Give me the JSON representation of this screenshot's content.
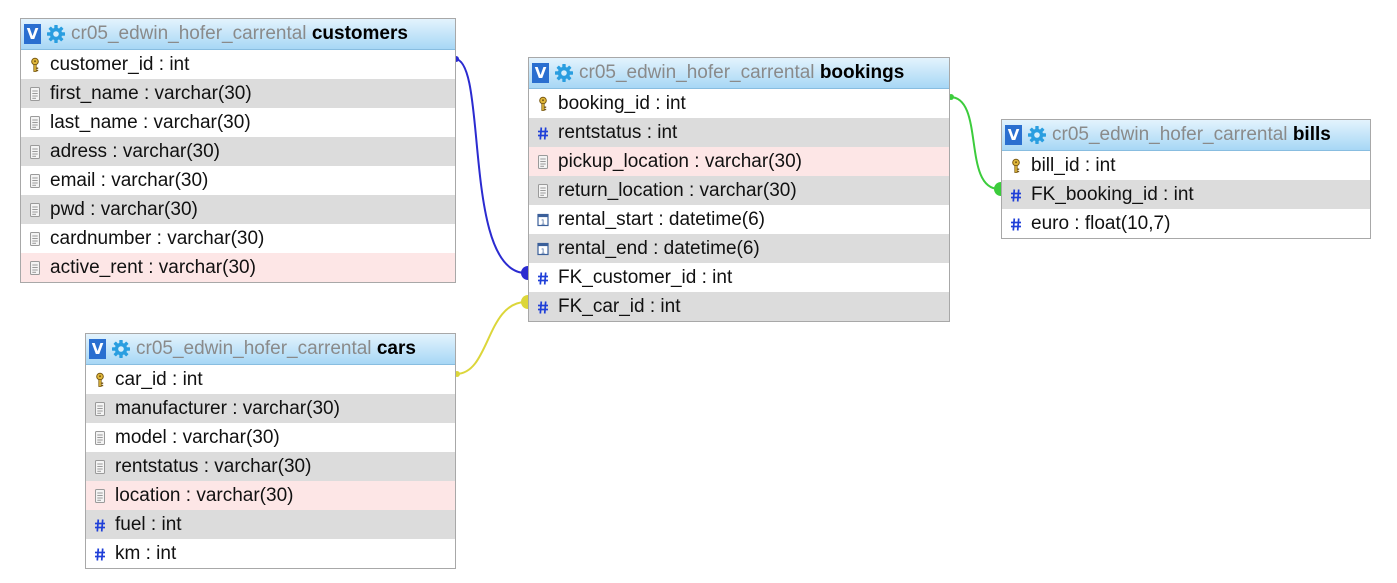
{
  "tables": {
    "customers": {
      "db": "cr05_edwin_hofer_carrental",
      "name": "customers",
      "columns": [
        {
          "label": "customer_id : int",
          "icon": "primary-key-icon"
        },
        {
          "label": "first_name : varchar(30)",
          "icon": "text-column-icon"
        },
        {
          "label": "last_name : varchar(30)",
          "icon": "text-column-icon"
        },
        {
          "label": "adress : varchar(30)",
          "icon": "text-column-icon"
        },
        {
          "label": "email : varchar(30)",
          "icon": "text-column-icon"
        },
        {
          "label": "pwd : varchar(30)",
          "icon": "text-column-icon"
        },
        {
          "label": "cardnumber : varchar(30)",
          "icon": "text-column-icon"
        },
        {
          "label": "active_rent : varchar(30)",
          "icon": "text-column-icon"
        }
      ]
    },
    "bookings": {
      "db": "cr05_edwin_hofer_carrental",
      "name": "bookings",
      "columns": [
        {
          "label": "booking_id : int",
          "icon": "primary-key-icon"
        },
        {
          "label": "rentstatus : int",
          "icon": "numeric-column-icon"
        },
        {
          "label": "pickup_location : varchar(30)",
          "icon": "text-column-icon"
        },
        {
          "label": "return_location : varchar(30)",
          "icon": "text-column-icon"
        },
        {
          "label": "rental_start : datetime(6)",
          "icon": "date-column-icon"
        },
        {
          "label": "rental_end : datetime(6)",
          "icon": "date-column-icon"
        },
        {
          "label": "FK_customer_id : int",
          "icon": "numeric-column-icon"
        },
        {
          "label": "FK_car_id : int",
          "icon": "numeric-column-icon"
        }
      ]
    },
    "bills": {
      "db": "cr05_edwin_hofer_carrental",
      "name": "bills",
      "columns": [
        {
          "label": "bill_id : int",
          "icon": "primary-key-icon"
        },
        {
          "label": "FK_booking_id : int",
          "icon": "numeric-column-icon"
        },
        {
          "label": "euro : float(10,7)",
          "icon": "numeric-column-icon"
        }
      ]
    },
    "cars": {
      "db": "cr05_edwin_hofer_carrental",
      "name": "cars",
      "columns": [
        {
          "label": "car_id : int",
          "icon": "primary-key-icon"
        },
        {
          "label": "manufacturer : varchar(30)",
          "icon": "text-column-icon"
        },
        {
          "label": "model : varchar(30)",
          "icon": "text-column-icon"
        },
        {
          "label": "rentstatus : varchar(30)",
          "icon": "text-column-icon"
        },
        {
          "label": "location : varchar(30)",
          "icon": "text-column-icon"
        },
        {
          "label": "fuel : int",
          "icon": "numeric-column-icon"
        },
        {
          "label": "km : int",
          "icon": "numeric-column-icon"
        }
      ]
    }
  },
  "header": {
    "toggle_label": "V",
    "toggle_icon": "collapse-toggle-icon",
    "settings_icon": "gear-icon"
  },
  "relations": [
    {
      "from": "customers.customer_id",
      "to": "bookings.FK_customer_id",
      "color": "#2b2bd0"
    },
    {
      "from": "cars.car_id",
      "to": "bookings.FK_car_id",
      "color": "#dcd63a"
    },
    {
      "from": "bookings.booking_id",
      "to": "bills.FK_booking_id",
      "color": "#3ccc3c"
    }
  ],
  "colors": {
    "header_top": "#e3f3fd",
    "header_bottom": "#a7d7f5",
    "row_alt": "#dcdcdc",
    "row_highlight": "#fde6e6",
    "db_name": "#8a8a8a",
    "toggle_bg": "#2a6fd0",
    "gear": "#2a9ee0",
    "numeric_icon": "#1f3fd8"
  }
}
